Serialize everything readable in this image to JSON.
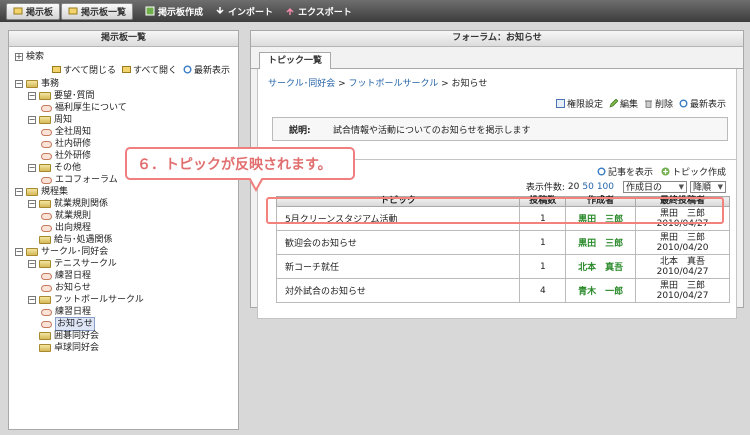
{
  "topbar": {
    "tabs": [
      {
        "label": "掲示板",
        "icon": "board-tab-icon"
      },
      {
        "label": "掲示板一覧",
        "icon": "board-list-tab-icon"
      }
    ],
    "tools": [
      {
        "label": "掲示板作成",
        "icon": "create-board-icon"
      },
      {
        "label": "インポート",
        "icon": "import-icon"
      },
      {
        "label": "エクスポート",
        "icon": "export-icon"
      }
    ]
  },
  "left": {
    "title": "掲示板一覧",
    "search_label": "検索",
    "collapse_all": "すべて閉じる",
    "expand_all": "すべて開く",
    "refresh": "最新表示",
    "tree": [
      {
        "label": "事務",
        "level": 0,
        "type": "category"
      },
      {
        "label": "要望･質問",
        "level": 1,
        "type": "folder"
      },
      {
        "label": "福利厚生について",
        "level": 2,
        "type": "board"
      },
      {
        "label": "周知",
        "level": 1,
        "type": "folder"
      },
      {
        "label": "全社周知",
        "level": 2,
        "type": "board"
      },
      {
        "label": "社内研修",
        "level": 2,
        "type": "board"
      },
      {
        "label": "社外研修",
        "level": 2,
        "type": "board"
      },
      {
        "label": "その他",
        "level": 1,
        "type": "folder"
      },
      {
        "label": "エコフォーラム",
        "level": 2,
        "type": "board"
      },
      {
        "label": "規程集",
        "level": 0,
        "type": "category"
      },
      {
        "label": "就業規則関係",
        "level": 1,
        "type": "folder"
      },
      {
        "label": "就業規則",
        "level": 2,
        "type": "board"
      },
      {
        "label": "出向規程",
        "level": 2,
        "type": "board"
      },
      {
        "label": "給与･処遇関係",
        "level": 1,
        "type": "folder-leaf"
      },
      {
        "label": "サークル･同好会",
        "level": 0,
        "type": "category"
      },
      {
        "label": "テニスサークル",
        "level": 1,
        "type": "folder"
      },
      {
        "label": "練習日程",
        "level": 2,
        "type": "board"
      },
      {
        "label": "お知らせ",
        "level": 2,
        "type": "board"
      },
      {
        "label": "フットボールサークル",
        "level": 1,
        "type": "folder"
      },
      {
        "label": "練習日程",
        "level": 2,
        "type": "board"
      },
      {
        "label": "お知らせ",
        "level": 2,
        "type": "board",
        "selected": true
      },
      {
        "label": "囲碁同好会",
        "level": 1,
        "type": "folder-leaf"
      },
      {
        "label": "卓球同好会",
        "level": 1,
        "type": "folder-leaf"
      }
    ]
  },
  "right": {
    "title": "フォーラム：お知らせ",
    "tab": "トピック一覧",
    "breadcrumb": {
      "part1": "サークル･同好会",
      "sep": " > ",
      "part2": "フットボールサークル",
      "part3": "お知らせ"
    },
    "actions": {
      "permission": "権限設定",
      "edit": "編集",
      "delete": "削除",
      "refresh": "最新表示"
    },
    "description": {
      "label": "説明:",
      "text": "試合情報や活動についてのお知らせを掲示します"
    },
    "article_display": "記事を表示",
    "topic_create": "トピック作成",
    "count_label": "表示件数:",
    "counts": [
      "20",
      "50",
      "100"
    ],
    "sort_field": "作成日の",
    "sort_order": "降順",
    "table": {
      "headers": {
        "topic": "トピック",
        "posts": "投稿数",
        "author": "作成者",
        "last": "最終投稿者"
      },
      "rows": [
        {
          "topic": "5月クリーンスタジアム活動",
          "posts": "1",
          "author": "黒田　三郎",
          "last_name": "黒田　三郎",
          "last_date": "2010/04/27"
        },
        {
          "topic": "歓迎会のお知らせ",
          "posts": "1",
          "author": "黒田　三郎",
          "last_name": "黒田　三郎",
          "last_date": "2010/04/20"
        },
        {
          "topic": "新コーチ就任",
          "posts": "1",
          "author": "北本　真吾",
          "last_name": "北本　真吾",
          "last_date": "2010/04/27"
        },
        {
          "topic": "対外試合のお知らせ",
          "posts": "4",
          "author": "青木　一郎",
          "last_name": "黒田　三郎",
          "last_date": "2010/04/27"
        }
      ]
    }
  },
  "callout": {
    "text": "６．トピックが反映されます。"
  },
  "colors": {
    "link": "#2563a8",
    "author": "#2a8a2a",
    "callout": "#f08080"
  }
}
